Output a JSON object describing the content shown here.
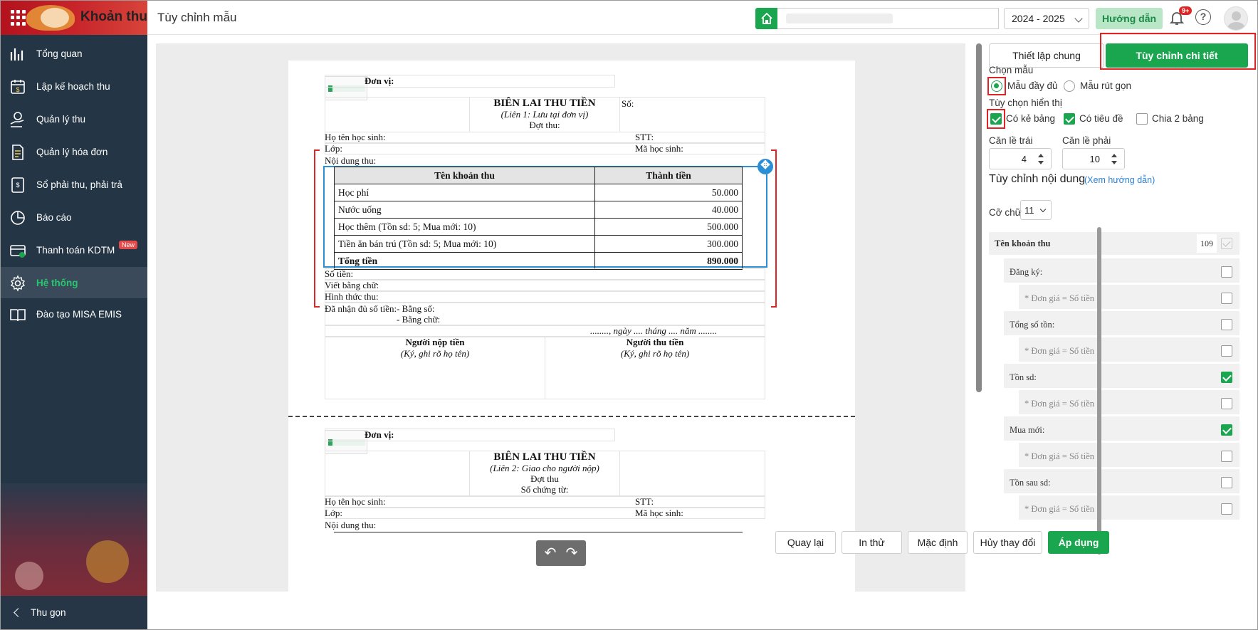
{
  "header": {
    "app_title": "Khoản thu",
    "page_title": "Tùy chỉnh mẫu",
    "school_year": "2024 - 2025",
    "guide_button": "Hướng dẫn",
    "notification_count": "9+"
  },
  "sidebar": {
    "items": [
      {
        "label": "Tổng quan",
        "icon": "bar-chart-icon"
      },
      {
        "label": "Lập kế hoạch thu",
        "icon": "calendar-money-icon"
      },
      {
        "label": "Quản lý thu",
        "icon": "hand-money-icon"
      },
      {
        "label": "Quản lý hóa đơn",
        "icon": "invoice-icon"
      },
      {
        "label": "Sổ phải thu, phải trả",
        "icon": "ledger-icon"
      },
      {
        "label": "Báo cáo",
        "icon": "pie-chart-icon"
      },
      {
        "label": "Thanh toán KDTM",
        "icon": "card-payment-icon",
        "badge": "New"
      },
      {
        "label": "Hệ thống",
        "icon": "gear-icon",
        "active": true
      },
      {
        "label": "Đào tạo MISA EMIS",
        "icon": "book-icon"
      }
    ],
    "collapse_label": "Thu gọn"
  },
  "receipt1": {
    "unit_label": "Đơn vị:",
    "title": "BIÊN LAI THU TIỀN",
    "subtitle": "(Liên 1: Lưu tại đơn vị)",
    "batch": "Đợt thu:",
    "number": "Số:",
    "student_name": "Họ tên học sinh:",
    "stt": "STT:",
    "class": "Lớp:",
    "student_code": "Mã học sinh:",
    "content": "Nội dung thu:",
    "table_headers": [
      "Tên khoản thu",
      "Thành tiền"
    ],
    "rows": [
      {
        "name": "Học phí",
        "amount": "50.000"
      },
      {
        "name": "Nước uống",
        "amount": "40.000"
      },
      {
        "name": "Học thêm (Tồn sd: 5; Mua mới: 10)",
        "amount": "500.000"
      },
      {
        "name": "Tiền ăn bán trú (Tồn sd: 5; Mua mới: 10)",
        "amount": "300.000"
      }
    ],
    "total_label": "Tổng tiền",
    "total_amount": "890.000",
    "amount_label": "Số tiền:",
    "in_words": "Viết bằng chữ:",
    "method": "Hình thức thu:",
    "received": "Đã nhận đủ số tiền:- Bằng số:",
    "received_words": "- Bằng chữ:",
    "date_line": "........,  ngày .... tháng .... năm ........",
    "payer": "Người nộp tiền",
    "payer_sign": "(Ký, ghi rõ họ tên)",
    "collector": "Người thu tiền",
    "collector_sign": "(Ký, ghi rõ họ tên)"
  },
  "receipt2": {
    "unit_label": "Đơn vị:",
    "title": "BIÊN LAI THU TIỀN",
    "subtitle": "(Liên 2: Giao cho người nộp)",
    "batch": "Đợt thu",
    "voucher": "Số chứng từ:",
    "student_name": "Họ tên học sinh:",
    "stt": "STT:",
    "class": "Lớp:",
    "student_code": "Mã học sinh:",
    "content": "Nội dung thu:"
  },
  "panel": {
    "tab_general": "Thiết lập chung",
    "tab_detail": "Tùy chỉnh chi tiết",
    "choose_template": "Chọn mẫu",
    "template_full": "Mẫu đầy đủ",
    "template_short": "Mẫu rút gọn",
    "display_options": "Tùy chọn hiển thị",
    "opt_borders": "Có kẻ bảng",
    "opt_titles": "Có tiêu đề",
    "opt_split": "Chia 2 bảng",
    "margin_left_label": "Căn lề trái",
    "margin_left_value": "4",
    "margin_right_label": "Căn lề phải",
    "margin_right_value": "10",
    "custom_content": "Tùy chỉnh nội dung",
    "help_link": "(Xem hướng dẫn)",
    "font_size_label": "Cỡ chữ",
    "font_size_value": "11",
    "col_name": "Tên khoản thu",
    "col_width": "109",
    "fields": [
      {
        "label": "Đăng ký:",
        "checked": false
      },
      {
        "label": "* Đơn giá = Số tiền",
        "checked": false
      },
      {
        "label": "Tổng số tồn:",
        "checked": false
      },
      {
        "label": "* Đơn giá = Số tiền",
        "checked": false
      },
      {
        "label": "Tồn sd:",
        "checked": true
      },
      {
        "label": "* Đơn giá = Số tiền",
        "checked": false
      },
      {
        "label": "Mua mới:",
        "checked": true
      },
      {
        "label": "* Đơn giá = Số tiền",
        "checked": false
      },
      {
        "label": "Tồn sau sd:",
        "checked": false
      },
      {
        "label": "* Đơn giá = Số tiền",
        "checked": false
      }
    ]
  },
  "footer": {
    "back": "Quay lại",
    "print_test": "In thử",
    "default": "Mặc định",
    "cancel": "Hủy thay đổi",
    "apply": "Áp dụng"
  },
  "colors": {
    "accent": "#1aa54f",
    "sidebar": "#243545",
    "highlight": "#e02424",
    "selection": "#2b8fd6"
  }
}
